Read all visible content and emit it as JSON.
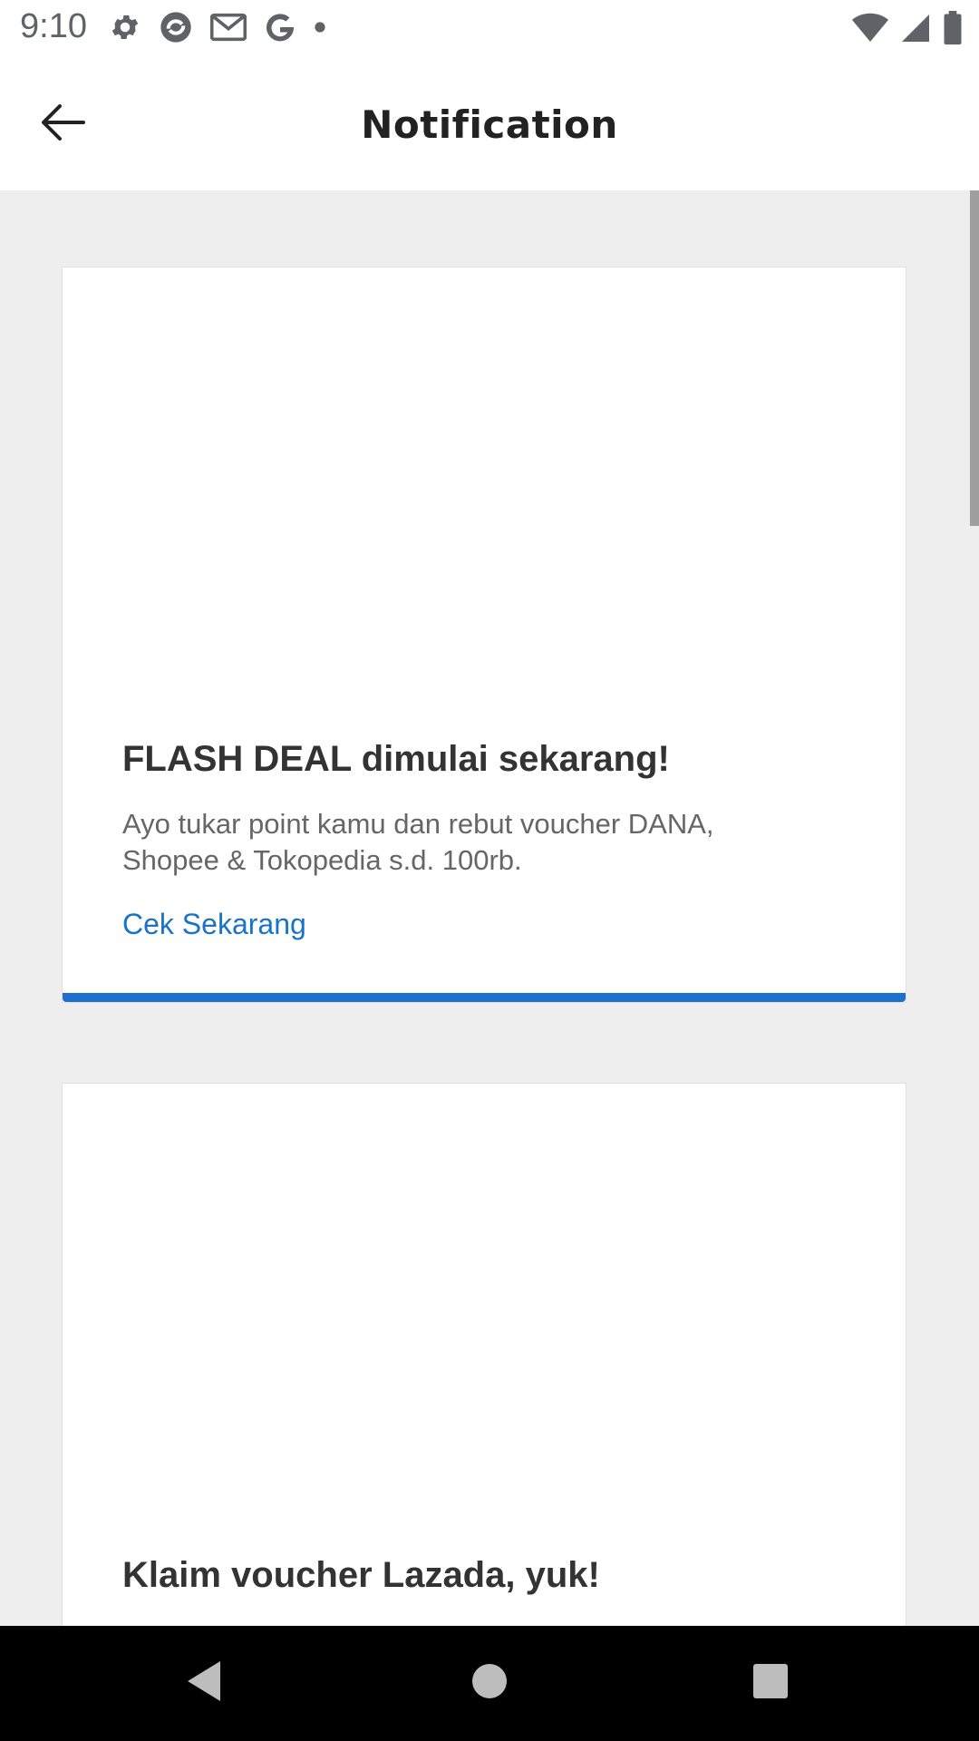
{
  "status_bar": {
    "time": "9:10",
    "left_icons": [
      "settings-gear-icon",
      "sync-app-icon",
      "gmail-icon",
      "google-g-icon",
      "notification-dot-icon"
    ],
    "right_icons": [
      "wifi-icon",
      "cell-signal-icon",
      "battery-icon"
    ]
  },
  "app_bar": {
    "title": "Notification",
    "back_icon": "arrow-left-icon"
  },
  "notifications": [
    {
      "title": "FLASH DEAL dimulai sekarang!",
      "body": "Ayo tukar point kamu dan rebut voucher DANA, Shopee & Tokopedia s.d. 100rb.",
      "link": "Cek Sekarang",
      "accent_color": "#1e6fce"
    },
    {
      "title": "Klaim voucher Lazada, yuk!"
    }
  ],
  "colors": {
    "link": "#1a73c8",
    "accent": "#1e6fce",
    "background": "#eeeeee"
  },
  "nav_bar": {
    "icons": [
      "nav-back-icon",
      "nav-home-icon",
      "nav-recents-icon"
    ]
  }
}
